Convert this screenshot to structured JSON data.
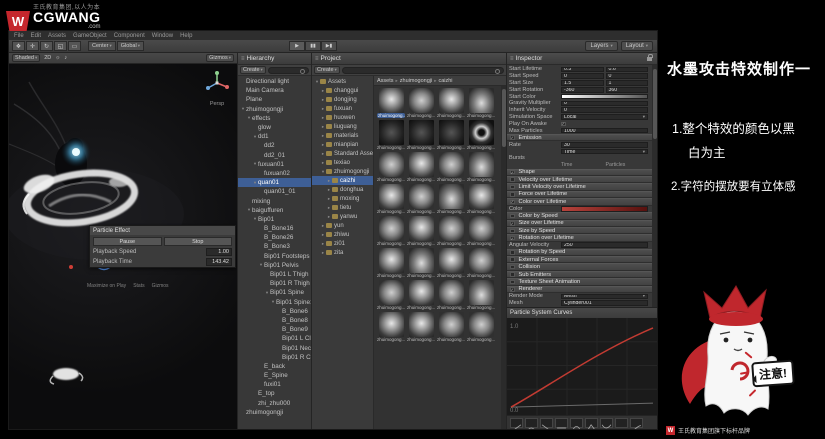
{
  "watermark": {
    "slogan": "王氏教育集团,以人为本",
    "brand": "CGWANG",
    "domain": ".com",
    "letter": "W"
  },
  "unity": {
    "menus": [
      "File",
      "Edit",
      "Assets",
      "GameObject",
      "Component",
      "Window",
      "Help"
    ],
    "toolbar": {
      "tools": [
        {
          "name": "hand-tool-icon",
          "glyph": "❖"
        },
        {
          "name": "move-tool-icon",
          "glyph": "✛"
        },
        {
          "name": "rotate-tool-icon",
          "glyph": "↻"
        },
        {
          "name": "scale-tool-icon",
          "glyph": "◱"
        },
        {
          "name": "rect-tool-icon",
          "glyph": "▭"
        }
      ],
      "pivot": {
        "center": "Center",
        "global": "Global"
      },
      "play": [
        {
          "name": "play-button",
          "glyph": "▶"
        },
        {
          "name": "pause-button",
          "glyph": "▮▮"
        },
        {
          "name": "step-button",
          "glyph": "▶▮"
        }
      ],
      "layers": "Layers",
      "layout": "Layout"
    },
    "scene": {
      "shaded": "Shaded",
      "mode2d": "2D",
      "gizmos_label": "Gizmos",
      "persp": "Persp",
      "particle_panel": {
        "title": "Particle Effect",
        "pause": "Pause",
        "stop": "Stop",
        "speed_label": "Playback Speed",
        "speed_value": "1.00",
        "time_label": "Playback Time",
        "time_value": "143.42"
      },
      "status": [
        "Maximize on Play",
        "Stats",
        "Gizmos"
      ]
    },
    "hierarchy": {
      "title": "Hierarchy",
      "create": "Create",
      "items": [
        {
          "label": "Directional light",
          "d": 0
        },
        {
          "label": "Main Camera",
          "d": 0
        },
        {
          "label": "Plane",
          "d": 0
        },
        {
          "label": "zhuimogongji",
          "d": 0,
          "e": 1
        },
        {
          "label": "effects",
          "d": 1,
          "e": 1
        },
        {
          "label": "glow",
          "d": 2
        },
        {
          "label": "dd1",
          "d": 2,
          "e": 1
        },
        {
          "label": "dd2",
          "d": 3
        },
        {
          "label": "dd2_01",
          "d": 3
        },
        {
          "label": "fuxuan01",
          "d": 2,
          "e": 1
        },
        {
          "label": "fuxuan02",
          "d": 3
        },
        {
          "label": "quan01",
          "d": 2,
          "e": 1,
          "sel": 1
        },
        {
          "label": "quan01_01",
          "d": 3
        },
        {
          "label": "mixing",
          "d": 1
        },
        {
          "label": "baiguffuren",
          "d": 1,
          "e": 1
        },
        {
          "label": "Bip01",
          "d": 2,
          "e": 1
        },
        {
          "label": "B_Bone16",
          "d": 3
        },
        {
          "label": "B_Bone26",
          "d": 3
        },
        {
          "label": "B_Bone3",
          "d": 3
        },
        {
          "label": "Bip01 Footsteps",
          "d": 3
        },
        {
          "label": "Bip01 Pelvis",
          "d": 3,
          "e": 1
        },
        {
          "label": "Bip01 L Thigh",
          "d": 4
        },
        {
          "label": "Bip01 R Thigh",
          "d": 4
        },
        {
          "label": "Bip01 Spine",
          "d": 4,
          "e": 1
        },
        {
          "label": "Bip01 Spine1",
          "d": 5,
          "e": 1
        },
        {
          "label": "B_Bone6",
          "d": 6
        },
        {
          "label": "B_Bone8",
          "d": 6
        },
        {
          "label": "B_Bone9",
          "d": 6
        },
        {
          "label": "Bip01 L Clavicle",
          "d": 6
        },
        {
          "label": "Bip01 Neck",
          "d": 6
        },
        {
          "label": "Bip01 R Clavicle",
          "d": 6
        },
        {
          "label": "E_back",
          "d": 3
        },
        {
          "label": "E_Spine",
          "d": 3
        },
        {
          "label": "fuxi01",
          "d": 3
        },
        {
          "label": "E_top",
          "d": 2
        },
        {
          "label": "zhi_zhu000",
          "d": 2
        },
        {
          "label": "zhuimogongji",
          "d": 0
        }
      ]
    },
    "project": {
      "title": "Project",
      "create": "Create",
      "folders": [
        {
          "label": "Assets",
          "d": 0,
          "e": 1
        },
        {
          "label": "changgui",
          "d": 1
        },
        {
          "label": "dongjing",
          "d": 1
        },
        {
          "label": "fuxuan",
          "d": 1
        },
        {
          "label": "huowen",
          "d": 1
        },
        {
          "label": "liuguang",
          "d": 1
        },
        {
          "label": "materials",
          "d": 1
        },
        {
          "label": "mianpian",
          "d": 1
        },
        {
          "label": "Standard Assets",
          "d": 1
        },
        {
          "label": "texiao",
          "d": 1
        },
        {
          "label": "zhuimogongji",
          "d": 1,
          "e": 1
        },
        {
          "label": "caizhi",
          "d": 2,
          "sel": 1
        },
        {
          "label": "donghua",
          "d": 2
        },
        {
          "label": "moxing",
          "d": 2
        },
        {
          "label": "tietu",
          "d": 2
        },
        {
          "label": "yanwu",
          "d": 2
        },
        {
          "label": "yun",
          "d": 1
        },
        {
          "label": "zhiwu",
          "d": 1
        },
        {
          "label": "zi01",
          "d": 1
        },
        {
          "label": "zita",
          "d": 1
        }
      ],
      "breadcrumb": [
        "Assets",
        "zhuimogongji",
        "caizhi"
      ],
      "grid": {
        "count": 32,
        "label": "zhuimogong...",
        "selected": 0
      }
    },
    "inspector": {
      "title": "Inspector",
      "rows": [
        {
          "t": "p",
          "label": "Start Lifetime",
          "v1": "0.5",
          "v2": "0.6"
        },
        {
          "t": "p",
          "label": "Start Speed",
          "v1": "0",
          "v2": "0"
        },
        {
          "t": "p",
          "label": "Start Size",
          "v1": "1.5",
          "v2": "1"
        },
        {
          "t": "p",
          "label": "Start Rotation",
          "v1": "-360",
          "v2": "360"
        },
        {
          "t": "col",
          "label": "Start Color"
        },
        {
          "t": "p",
          "label": "Gravity Multiplier",
          "v1": "0"
        },
        {
          "t": "p",
          "label": "Inherit Velocity",
          "v1": "0"
        },
        {
          "t": "dd",
          "label": "Simulation Space",
          "v1": "Local"
        },
        {
          "t": "chk",
          "label": "Play On Awake",
          "on": 1
        },
        {
          "t": "p",
          "label": "Max Particles",
          "v1": "1000"
        },
        {
          "t": "sec",
          "label": "Emission",
          "on": 1
        },
        {
          "t": "p",
          "label": "Rate",
          "v1": "30"
        },
        {
          "t": "dd",
          "label": "",
          "v1": "Time"
        },
        {
          "t": "lbl",
          "label": "Bursts"
        },
        {
          "t": "two",
          "label": "",
          "a": "Time",
          "b": "Particles"
        },
        {
          "t": "sec",
          "label": "Shape",
          "on": 1
        },
        {
          "t": "sec",
          "label": "Velocity over Lifetime",
          "on": 0
        },
        {
          "t": "sec",
          "label": "Limit Velocity over Lifetime",
          "on": 0
        },
        {
          "t": "sec",
          "label": "Force over Lifetime",
          "on": 0
        },
        {
          "t": "sec",
          "label": "Color over Lifetime",
          "on": 1
        },
        {
          "t": "grad",
          "label": "Color"
        },
        {
          "t": "sec",
          "label": "Color by Speed",
          "on": 0
        },
        {
          "t": "sec",
          "label": "Size over Lifetime",
          "on": 1
        },
        {
          "t": "sec",
          "label": "Size by Speed",
          "on": 0
        },
        {
          "t": "sec",
          "label": "Rotation over Lifetime",
          "on": 1
        },
        {
          "t": "p",
          "label": "Angular Velocity",
          "v1": "250"
        },
        {
          "t": "sec",
          "label": "Rotation by Speed",
          "on": 0
        },
        {
          "t": "sec",
          "label": "External Forces",
          "on": 0
        },
        {
          "t": "sec",
          "label": "Collision",
          "on": 0
        },
        {
          "t": "sec",
          "label": "Sub Emitters",
          "on": 0
        },
        {
          "t": "sec",
          "label": "Texture Sheet Animation",
          "on": 0
        },
        {
          "t": "sec",
          "label": "Renderer",
          "on": 1
        },
        {
          "t": "dd",
          "label": "Render Mode",
          "v1": "Mesh"
        },
        {
          "t": "p",
          "label": "Mesh",
          "v1": "Cylinder001"
        }
      ],
      "curves": {
        "title": "Particle System Curves",
        "y_max": "1.0",
        "y_min": "0.0"
      }
    }
  },
  "notes": {
    "title": "水墨攻击特效制作一",
    "line1": "1.整个特效的颜色以黑",
    "line1b": "白为主",
    "line2": "2.字符的摆放要有立体感",
    "bubble": "注意!"
  },
  "footer": {
    "brand": "王氏教育集团旗下标杆品牌",
    "logo_letter": "W"
  }
}
